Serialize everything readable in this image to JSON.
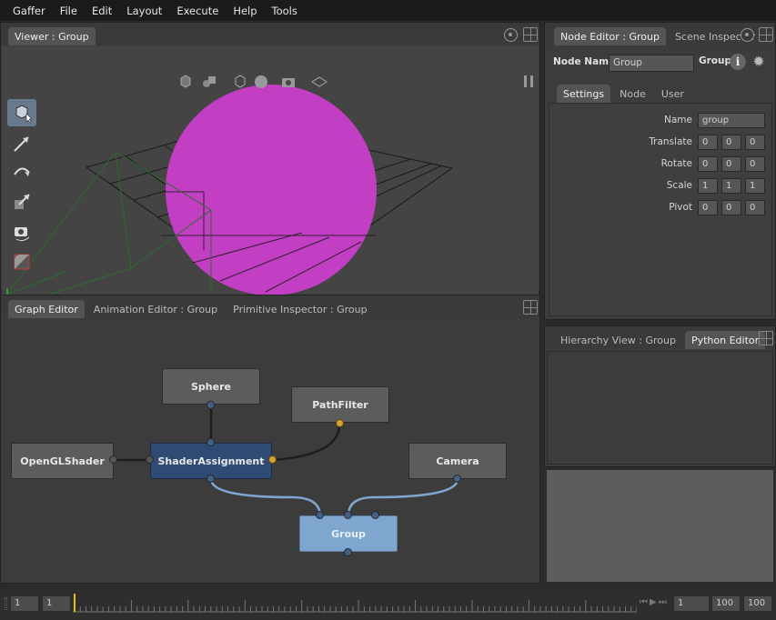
{
  "menu": [
    "Gaffer",
    "File",
    "Edit",
    "Layout",
    "Execute",
    "Help",
    "Tools"
  ],
  "viewer": {
    "tab": "Viewer : Group",
    "sphere_color": "#c23ec3",
    "tools": [
      "selection-tool",
      "translate-tool",
      "rotate-tool",
      "scale-tool",
      "camera-tool",
      "crop-window-tool"
    ]
  },
  "graph_panel": {
    "tabs": [
      "Graph Editor",
      "Animation Editor : Group",
      "Primitive Inspector : Group"
    ],
    "nodes": {
      "sphere": "Sphere",
      "pathfilter": "PathFilter",
      "openglshader": "OpenGLShader",
      "shaderassignment": "ShaderAssignment",
      "camera": "Camera",
      "group": "Group"
    }
  },
  "node_editor": {
    "tabs": [
      "Node Editor : Group",
      "Scene Inspector"
    ],
    "node_name_label": "Node Name",
    "node_name_value": "Group",
    "node_type": "Group",
    "sub_tabs": [
      "Settings",
      "Node",
      "User"
    ],
    "params": {
      "name_label": "Name",
      "name_value": "group",
      "translate_label": "Translate",
      "translate": [
        "0",
        "0",
        "0"
      ],
      "rotate_label": "Rotate",
      "rotate": [
        "0",
        "0",
        "0"
      ],
      "scale_label": "Scale",
      "scale": [
        "1",
        "1",
        "1"
      ],
      "pivot_label": "Pivot",
      "pivot": [
        "0",
        "0",
        "0"
      ]
    }
  },
  "lower_right": {
    "tabs": [
      "Hierarchy View : Group",
      "Python Editor"
    ]
  },
  "timeline": {
    "start": "1",
    "current": "1",
    "frame": "1",
    "end": "100",
    "end2": "100"
  }
}
